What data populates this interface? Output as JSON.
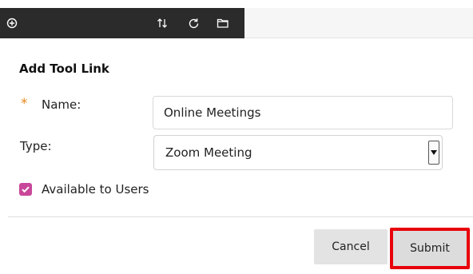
{
  "toolbar": {
    "icons": [
      "plus-circle-icon",
      "sort-arrows-icon",
      "refresh-icon",
      "folder-icon"
    ]
  },
  "form": {
    "title": "Add Tool Link",
    "required_marker": "*",
    "name_label": "Name:",
    "name_value": "Online Meetings",
    "type_label": "Type:",
    "type_value": "Zoom Meeting",
    "available_label": "Available to Users",
    "available_checked": true
  },
  "actions": {
    "cancel_label": "Cancel",
    "submit_label": "Submit"
  },
  "colors": {
    "toolbar_bg": "#2b2b2b",
    "required_star": "#e8871e",
    "checkbox": "#c9479a",
    "highlight_box": "#e8000b"
  }
}
